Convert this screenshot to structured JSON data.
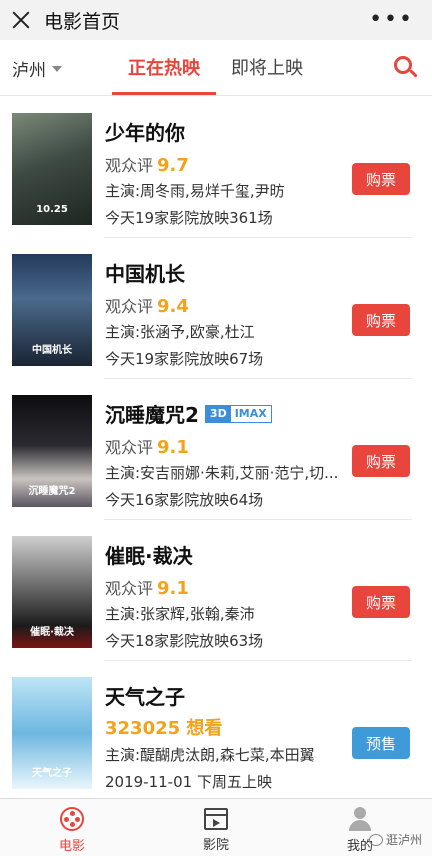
{
  "topbar": {
    "title": "电影首页",
    "close_icon": "close-icon",
    "more_icon": "more-icon",
    "more_glyph": "•••"
  },
  "tabs": {
    "city": "泸州",
    "now_showing": "正在热映",
    "coming_soon": "即将上映",
    "accent": "#e8453c"
  },
  "movies": [
    {
      "title": "少年的你",
      "score_label": "观众评",
      "score": "9.7",
      "cast": "主演:周冬雨,易烊千玺,尹昉",
      "showing": "今天19家影院放映361场",
      "button": "购票",
      "poster_text": "10.25"
    },
    {
      "title": "中国机长",
      "score_label": "观众评",
      "score": "9.4",
      "cast": "主演:张涵予,欧豪,杜江",
      "showing": "今天19家影院放映67场",
      "button": "购票",
      "poster_text": "中国机长"
    },
    {
      "title": "沉睡魔咒2",
      "badge_3d": "3D",
      "badge_imax": "IMAX",
      "score_label": "观众评",
      "score": "9.1",
      "cast": "主演:安吉丽娜·朱莉,艾丽·范宁,切...",
      "showing": "今天16家影院放映64场",
      "button": "购票",
      "poster_text": "沉睡魔咒2"
    },
    {
      "title": "催眠·裁决",
      "score_label": "观众评",
      "score": "9.1",
      "cast": "主演:张家辉,张翰,秦沛",
      "showing": "今天18家影院放映63场",
      "button": "购票",
      "poster_text": "催眠·裁决"
    },
    {
      "title": "天气之子",
      "want": "323025 想看",
      "cast": "主演:醍醐虎汰朗,森七菜,本田翼",
      "showing": "2019-11-01 下周五上映",
      "button": "预售",
      "poster_text": "天气之子"
    }
  ],
  "bottom_nav": {
    "movies": "电影",
    "cinemas": "影院",
    "mine": "我的",
    "watermark": "逛泸州"
  },
  "colors": {
    "buy_button": "#e8453c",
    "presale_button": "#3f9ad9",
    "score": "#f3a21b"
  }
}
